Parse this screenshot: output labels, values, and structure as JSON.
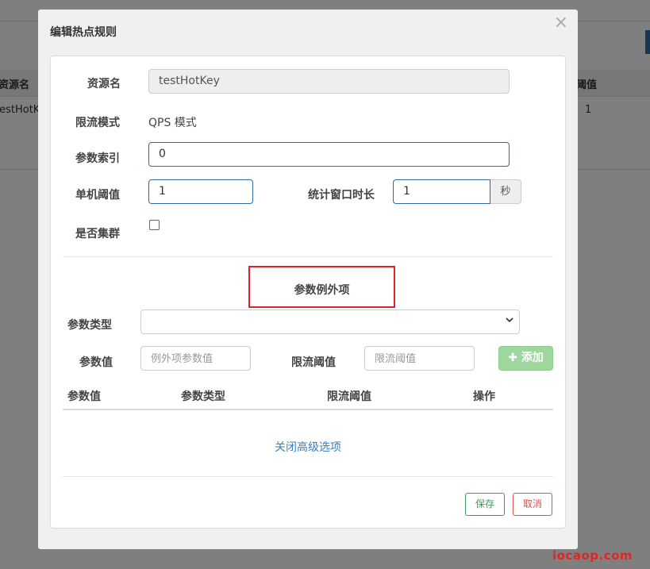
{
  "background": {
    "table_header_left": "资源名",
    "table_header_right": "阈值",
    "row_resource": "testHotKey",
    "row_threshold": "1"
  },
  "modal": {
    "title": "编辑热点规则",
    "close": "×"
  },
  "form": {
    "resource_label": "资源名",
    "resource_value": "testHotKey",
    "mode_label": "限流模式",
    "mode_value": "QPS 模式",
    "param_index_label": "参数索引",
    "param_index_value": "0",
    "single_threshold_label": "单机阈值",
    "single_threshold_value": "1",
    "window_label": "统计窗口时长",
    "window_value": "1",
    "window_unit": "秒",
    "cluster_label": "是否集群"
  },
  "exceptions": {
    "title": "参数例外项",
    "param_type_label": "参数类型",
    "param_value_label": "参数值",
    "param_value_placeholder": "例外项参数值",
    "limit_label": "限流阈值",
    "limit_placeholder": "限流阈值",
    "add_button": "✚ 添加",
    "columns": [
      "参数值",
      "参数类型",
      "限流阈值",
      "操作"
    ],
    "close_advanced": "关闭高级选项"
  },
  "footer": {
    "save": "保存",
    "cancel": "取消"
  },
  "watermark": "iocaop.com"
}
